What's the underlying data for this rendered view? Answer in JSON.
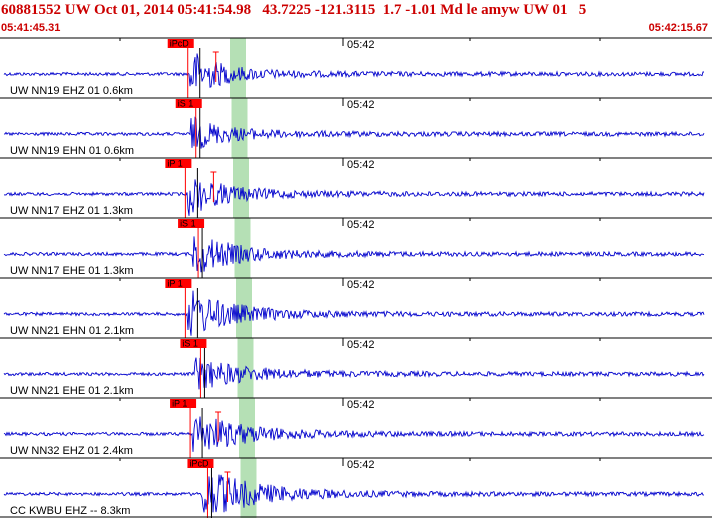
{
  "header": {
    "title": "60881552 UW Oct 01, 2014 05:41:54.98   43.7225 -121.3115  1.7 -1.01 Md le amyw UW 01   5",
    "start_time": "05:41:45.31",
    "end_time": "05:42:15.67"
  },
  "colors": {
    "title": "#cc0000",
    "trace": "#0000cc",
    "pick": "#ff0000",
    "window_highlight": "#b5e0b5",
    "panel_border": "#000000"
  },
  "time_axis": {
    "start_seconds": 45.31,
    "end_seconds": 75.67
  },
  "panels": [
    {
      "label": "UW NN19 EHZ 01 0.6km",
      "tick_label": "05:42",
      "pick_label": "iPcD",
      "onset_seconds": 53.4,
      "amplitude": 0.85,
      "peak_marker": true
    },
    {
      "label": "UW NN19 EHN 01 0.6km",
      "tick_label": "05:42",
      "pick_label": "iS 1",
      "onset_seconds": 53.4,
      "amplitude": 0.55,
      "peak_marker": false
    },
    {
      "label": "UW NN17 EHZ 01 1.3km",
      "tick_label": "05:42",
      "pick_label": "iP 1",
      "onset_seconds": 53.3,
      "amplitude": 0.7,
      "peak_marker": true
    },
    {
      "label": "UW NN17 EHE 01 1.3km",
      "tick_label": "05:42",
      "pick_label": "iS 1",
      "onset_seconds": 53.5,
      "amplitude": 0.75,
      "peak_marker": false
    },
    {
      "label": "UW NN21 EHN 01 2.1km",
      "tick_label": "05:42",
      "pick_label": "iP 1",
      "onset_seconds": 53.3,
      "amplitude": 0.85,
      "peak_marker": false
    },
    {
      "label": "UW NN21 EHE 01 2.1km",
      "tick_label": "05:42",
      "pick_label": "iS 1",
      "onset_seconds": 53.6,
      "amplitude": 0.55,
      "peak_marker": false
    },
    {
      "label": "UW NN32 EHZ 01 2.4km",
      "tick_label": "05:42",
      "pick_label": "iP 1",
      "onset_seconds": 53.5,
      "amplitude": 0.75,
      "peak_marker": true
    },
    {
      "label": "CC KWBU EHZ -- 8.3km",
      "tick_label": "05:42",
      "pick_label": "iPcD",
      "onset_seconds": 53.9,
      "amplitude": 0.9,
      "peak_marker": true
    }
  ]
}
